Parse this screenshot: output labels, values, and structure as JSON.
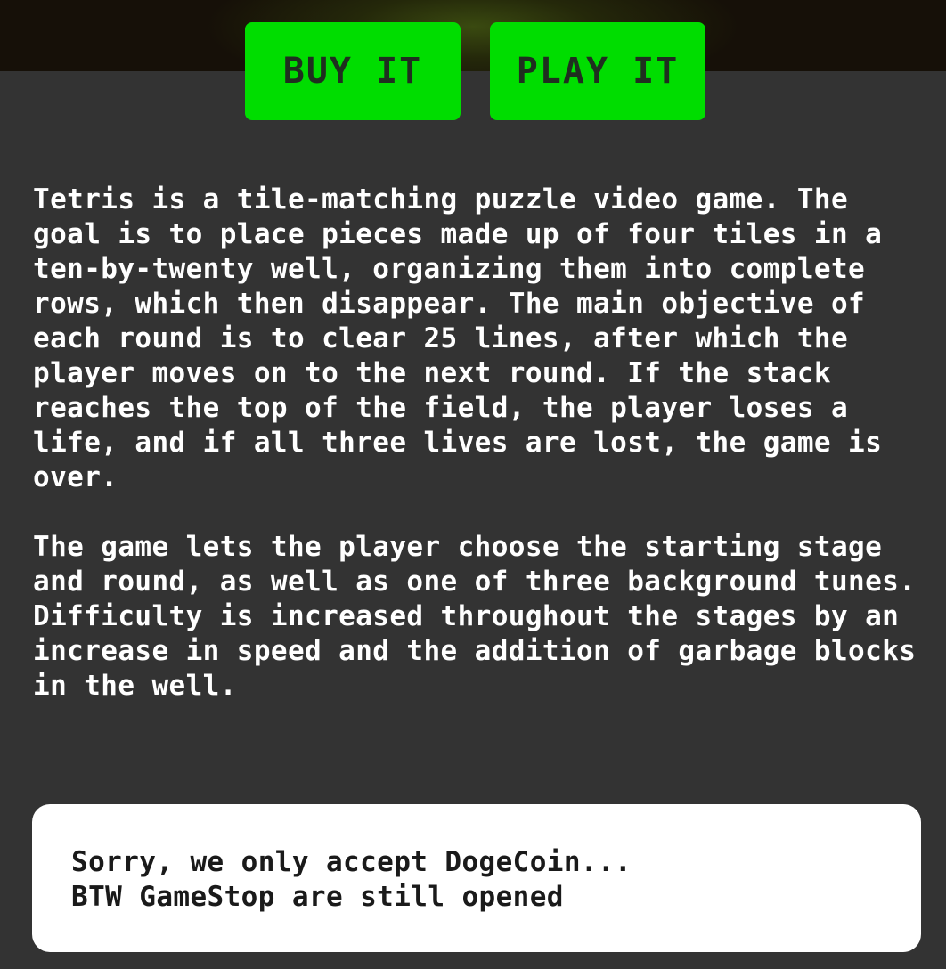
{
  "actions": {
    "buy_label": "BUY IT",
    "play_label": "PLAY IT"
  },
  "description": {
    "paragraph_1": "Tetris is a tile-matching puzzle video game. The goal is to place pieces made up of four tiles in a ten-by-twenty well, organizing them into complete rows, which then disappear. The main objective of each round is to clear 25 lines, after which the player moves on to the next round. If the stack reaches the top of the field, the player loses a life, and if all three lives are lost, the game is over.",
    "paragraph_2": "The game lets the player choose the starting stage and round, as well as one of three background tunes. Difficulty is increased throughout the stages by an increase in speed and the addition of garbage blocks in the well."
  },
  "notice": {
    "line_1": "Sorry, we only accept DogeCoin...",
    "line_2": "BTW GameStop are still opened"
  },
  "colors": {
    "page_background": "#333333",
    "button_green": "#00dd00",
    "button_text": "#1f2f1f",
    "text": "#ffffff",
    "notice_background": "#ffffff"
  }
}
